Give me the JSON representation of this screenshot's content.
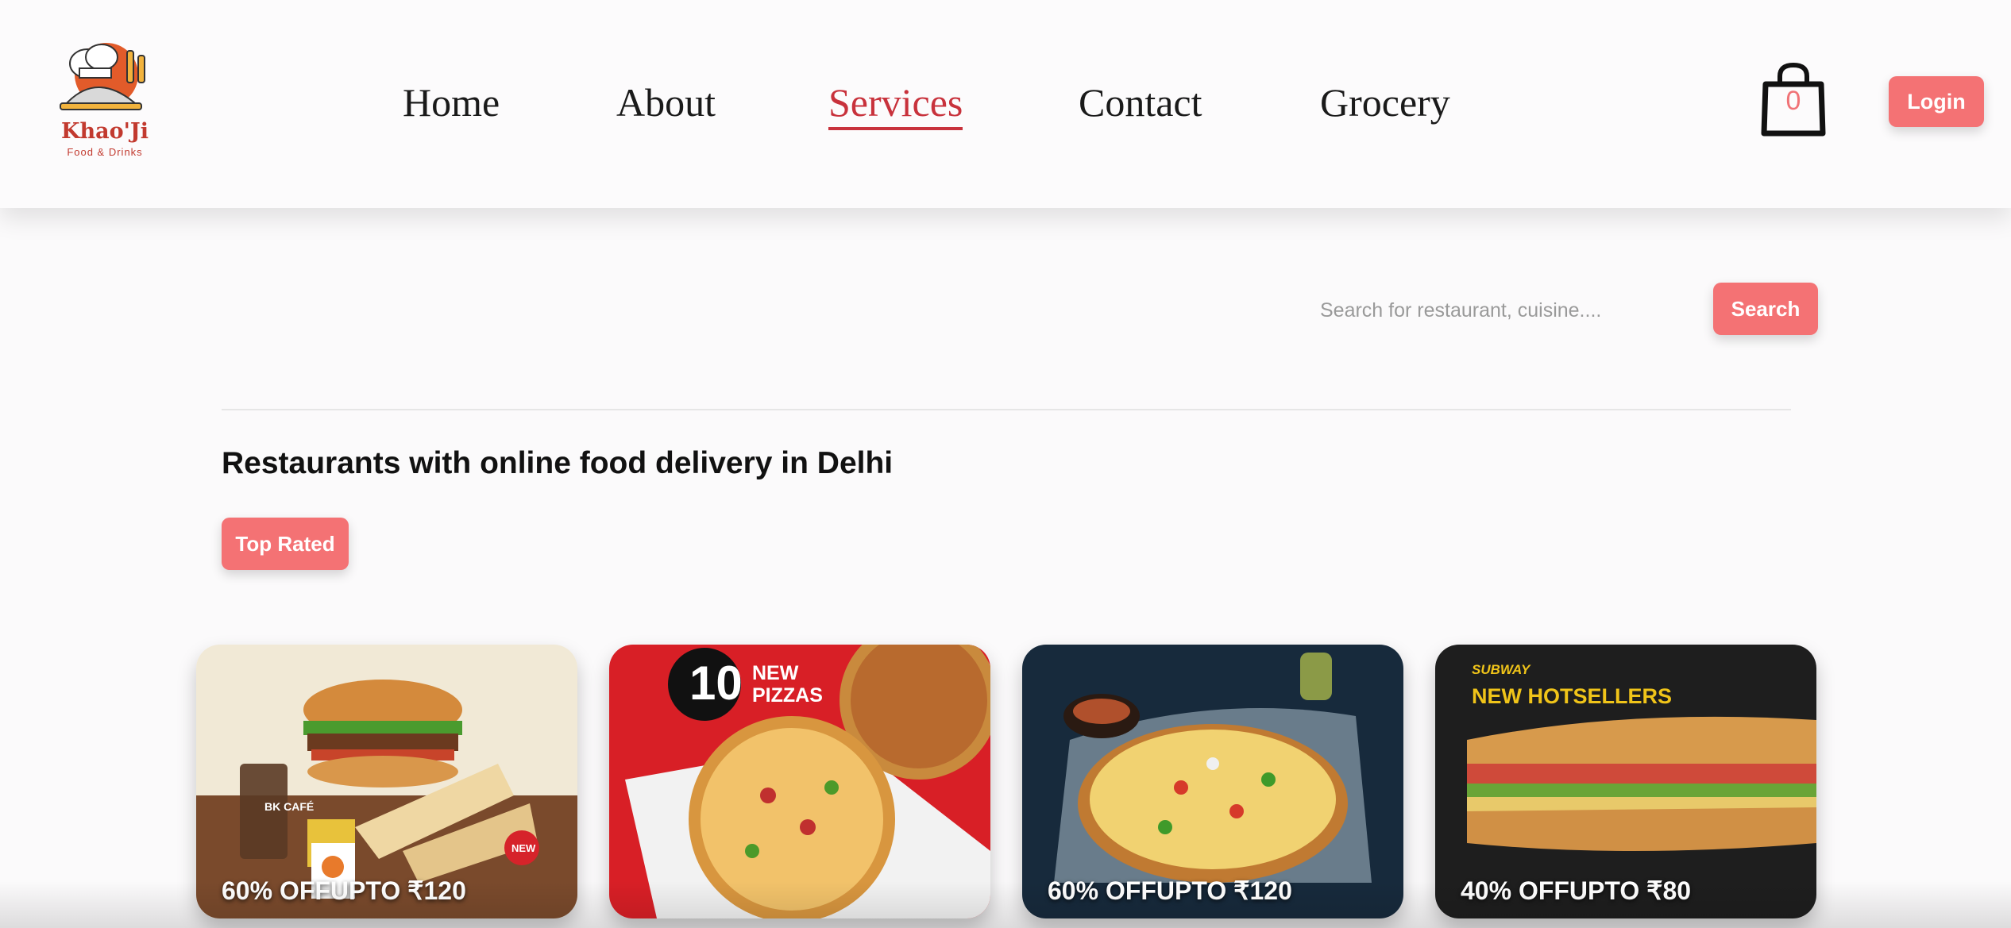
{
  "brand": {
    "name": "Khao'Ji",
    "tagline": "Food & Drinks"
  },
  "nav": {
    "items": [
      {
        "label": "Home"
      },
      {
        "label": "About"
      },
      {
        "label": "Services"
      },
      {
        "label": "Contact"
      },
      {
        "label": "Grocery"
      }
    ],
    "active": "Services"
  },
  "cart": {
    "count": "0",
    "icon": "shopping-bag-icon"
  },
  "login_label": "Login",
  "search": {
    "placeholder": "Search for restaurant, cuisine....",
    "button_label": "Search"
  },
  "section_title": "Restaurants with online food delivery in Delhi",
  "filter_label": "Top Rated",
  "colors": {
    "accent": "#f47274",
    "active_nav": "#c8323c"
  },
  "cards": [
    {
      "offer": "60% OFFUPTO ₹120",
      "image": "burger-combo",
      "badge": "NEW",
      "overlay": "BK CAFÉ"
    },
    {
      "offer": "",
      "image": "pizza-hut-pizzas",
      "overlay_number": "10",
      "overlay": "NEW PIZZAS"
    },
    {
      "offer": "60% OFFUPTO ₹120",
      "image": "veg-pizza"
    },
    {
      "offer": "40% OFFUPTO ₹80",
      "image": "subway-sandwich",
      "overlay_brand": "SUBWAY",
      "overlay": "NEW HOTSELLERS"
    }
  ]
}
